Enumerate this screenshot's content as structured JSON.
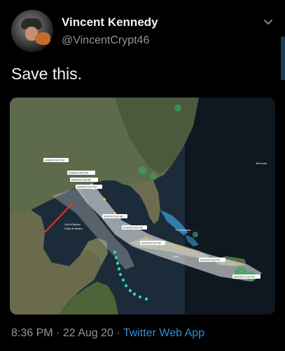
{
  "user": {
    "display_name": "Vincent Kennedy",
    "handle": "@VincentCrypt46"
  },
  "tweet": {
    "text": "Save this."
  },
  "footer": {
    "time": "8:36 PM",
    "date": "22 Aug 20",
    "source": "Twitter Web App",
    "separator": "·"
  },
  "map": {
    "places": [
      "Gulf of Mexico",
      "Golfo de Mexico",
      "Cuba",
      "The Bahamas",
      "Bermuda"
    ],
    "forecast_points": [
      "8/26/2020 6:00 PM",
      "8/25/2020 6:00 PM",
      "8/25/2020 6:00 AM",
      "8/24/2020 6:00 PM",
      "8/24/2020 6:00 AM",
      "8/23/2020 6:00 PM",
      "8/23/2020 6:00 AM",
      "8/22/2020 6:00 PM",
      "8/22/2020 12:00 PM"
    ]
  },
  "icons": {
    "menu": "chevron-down-icon",
    "avatar": "avatar-photo"
  },
  "colors": {
    "background": "#000000",
    "secondary_text": "#8C96A0",
    "link": "#2A8FDB",
    "arrow": "#E5332A",
    "track": "#2ED6B4",
    "cone": "#FFFFFF"
  }
}
